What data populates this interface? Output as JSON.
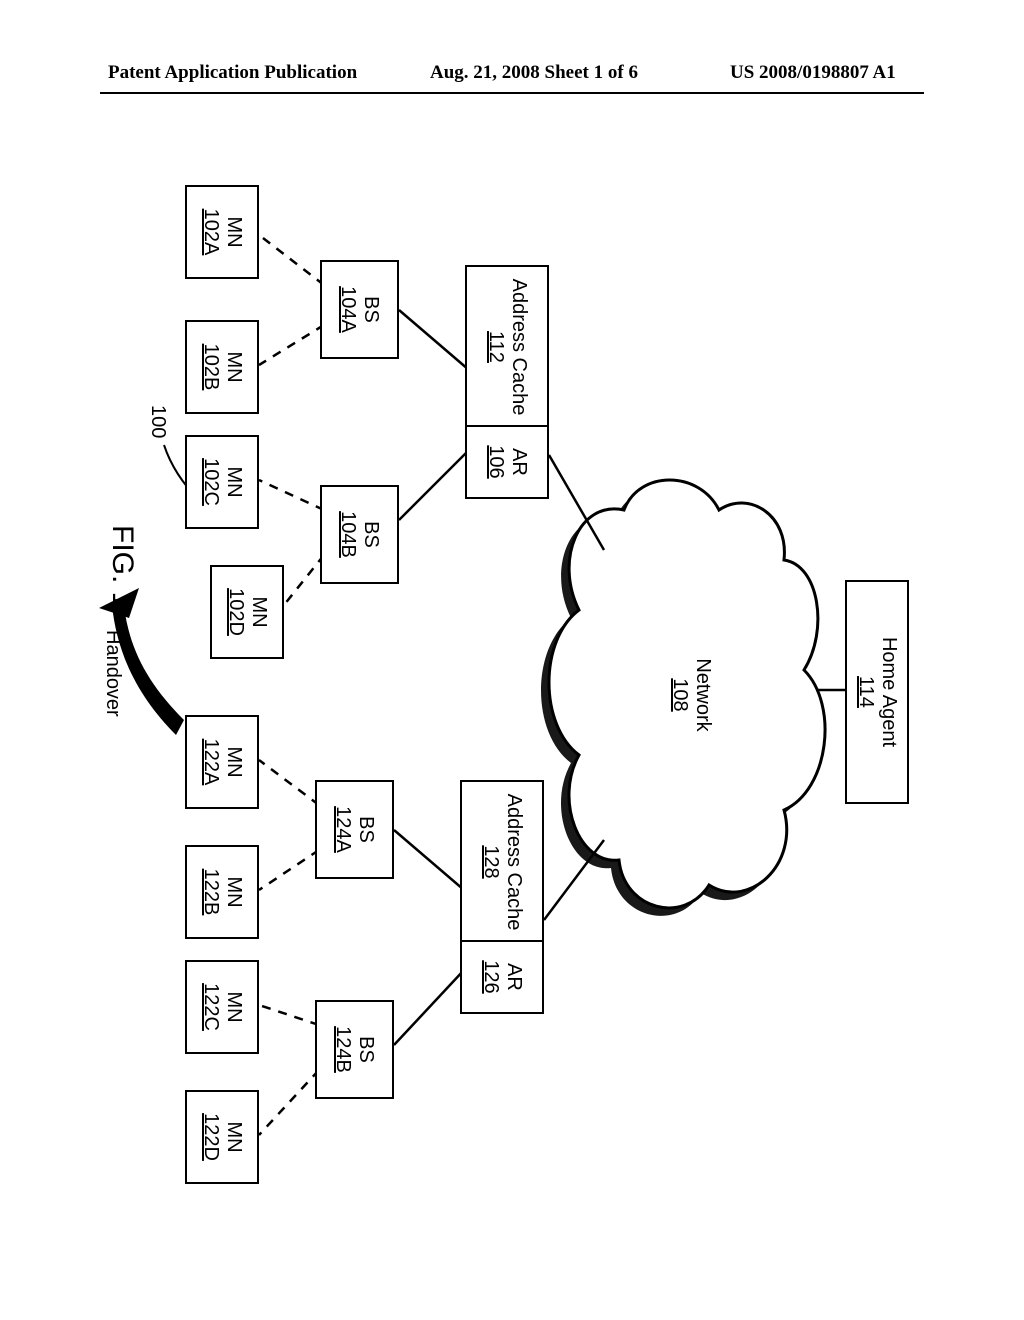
{
  "header": {
    "left": "Patent Application Publication",
    "middle": "Aug. 21, 2008  Sheet 1 of 6",
    "right": "US 2008/0198807 A1"
  },
  "figure_caption": "FIG. 1",
  "ref_100": "100",
  "handover_label": "Handover",
  "home_agent": {
    "title": "Home Agent",
    "ref": "114"
  },
  "network": {
    "title": "Network",
    "ref": "108"
  },
  "ar_left": {
    "title": "AR",
    "ref": "106"
  },
  "ar_right": {
    "title": "AR",
    "ref": "126"
  },
  "addr_left": {
    "title": "Address Cache",
    "ref": "112"
  },
  "addr_right": {
    "title": "Address Cache",
    "ref": "128"
  },
  "bs_104a": {
    "title": "BS",
    "ref": "104A"
  },
  "bs_104b": {
    "title": "BS",
    "ref": "104B"
  },
  "bs_124a": {
    "title": "BS",
    "ref": "124A"
  },
  "bs_124b": {
    "title": "BS",
    "ref": "124B"
  },
  "mn_102a": {
    "title": "MN",
    "ref": "102A"
  },
  "mn_102b": {
    "title": "MN",
    "ref": "102B"
  },
  "mn_102c": {
    "title": "MN",
    "ref": "102C"
  },
  "mn_102d": {
    "title": "MN",
    "ref": "102D"
  },
  "mn_122a": {
    "title": "MN",
    "ref": "122A"
  },
  "mn_122b": {
    "title": "MN",
    "ref": "122B"
  },
  "mn_122c": {
    "title": "MN",
    "ref": "122C"
  },
  "mn_122d": {
    "title": "MN",
    "ref": "122D"
  }
}
